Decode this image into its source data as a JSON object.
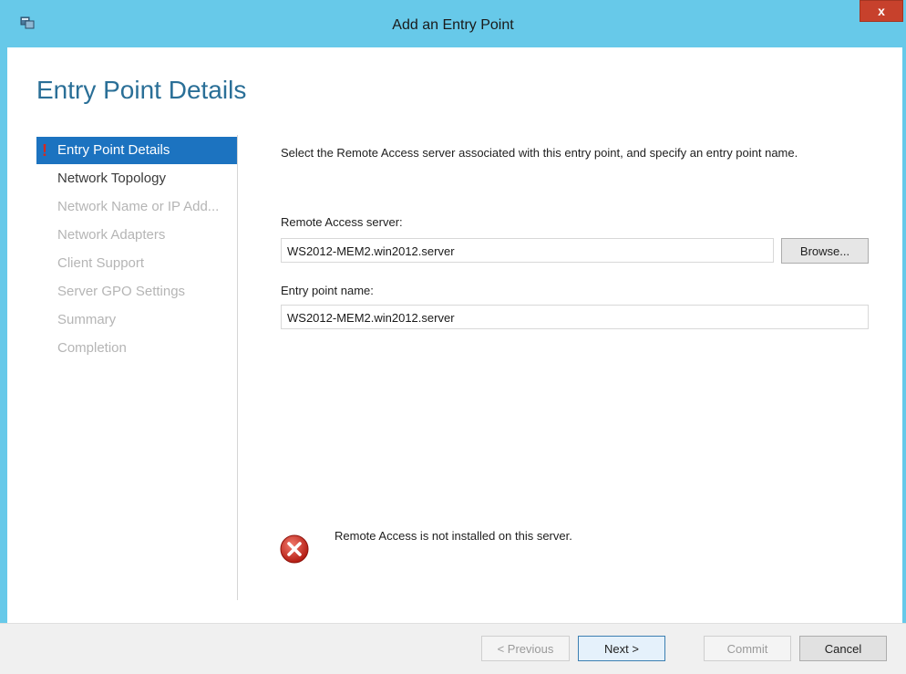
{
  "window": {
    "title": "Add an Entry Point",
    "close_label": "x",
    "app_icon": "wizard-app-icon"
  },
  "page": {
    "heading": "Entry Point Details"
  },
  "nav": {
    "items": [
      {
        "label": "Entry Point Details",
        "state": "active",
        "warning": "!"
      },
      {
        "label": "Network Topology",
        "state": "enabled"
      },
      {
        "label": "Network Name or IP Add...",
        "state": "disabled"
      },
      {
        "label": "Network Adapters",
        "state": "disabled"
      },
      {
        "label": "Client Support",
        "state": "disabled"
      },
      {
        "label": "Server GPO Settings",
        "state": "disabled"
      },
      {
        "label": "Summary",
        "state": "disabled"
      },
      {
        "label": "Completion",
        "state": "disabled"
      }
    ]
  },
  "form": {
    "description": "Select the Remote Access server associated with this entry point, and specify an entry point name.",
    "server_label": "Remote Access server:",
    "server_value": "WS2012-MEM2.win2012.server",
    "browse_label": "Browse...",
    "entry_name_label": "Entry point name:",
    "entry_name_value": "WS2012-MEM2.win2012.server"
  },
  "error": {
    "icon": "error-icon",
    "message": "Remote Access is not installed on this server."
  },
  "footer": {
    "previous_label": "< Previous",
    "next_label": "Next >",
    "commit_label": "Commit",
    "cancel_label": "Cancel"
  },
  "colors": {
    "title_bar": "#67c9e9",
    "accent": "#1c73c0",
    "heading": "#2a6f97",
    "close": "#c7412c",
    "error": "#d9281c"
  }
}
